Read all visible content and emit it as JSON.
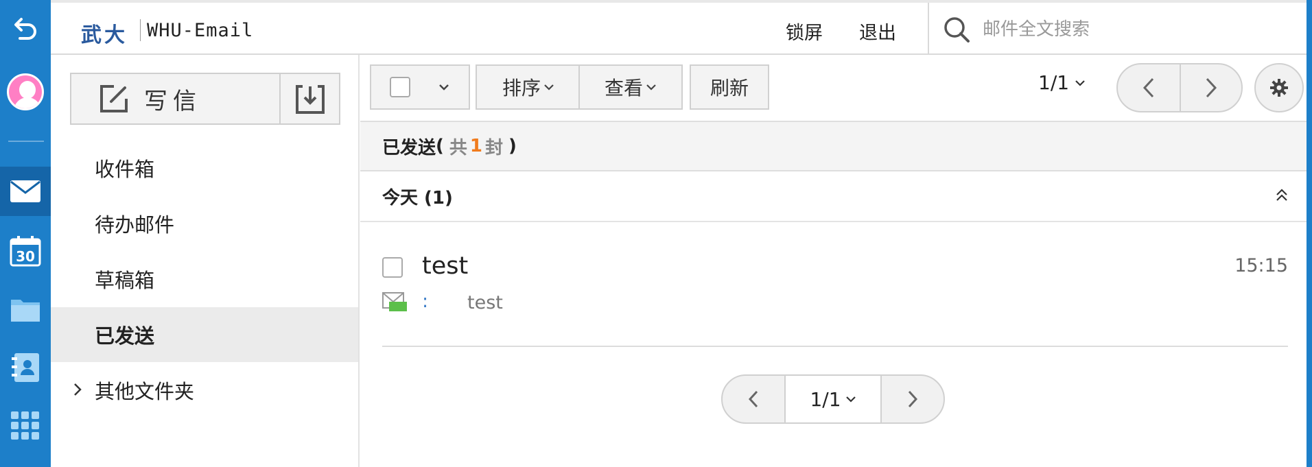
{
  "app": {
    "logo": "武大",
    "logo_sub": "WHU-Email"
  },
  "header": {
    "lock_label": "锁屏",
    "logout_label": "退出",
    "search_placeholder": "邮件全文搜索"
  },
  "rail": {
    "items": [
      "back-icon",
      "avatar",
      "mail-icon",
      "calendar-icon",
      "folder-icon",
      "contacts-icon",
      "apps-grid-icon"
    ],
    "calendar_day": "30",
    "active": "mail-icon"
  },
  "sidebar": {
    "compose_label": "写信",
    "folders": [
      {
        "label": "收件箱"
      },
      {
        "label": "待办邮件"
      },
      {
        "label": "草稿箱"
      },
      {
        "label": "已发送",
        "active": true
      },
      {
        "label": "其他文件夹",
        "expandable": true
      }
    ]
  },
  "toolbar": {
    "sort_label": "排序",
    "view_label": "查看",
    "refresh_label": "刷新",
    "page_indicator": "1/1"
  },
  "folder_header": {
    "name": "已发送",
    "open_paren": "(",
    "prefix": "共",
    "count": "1",
    "suffix": "封",
    "close_paren": ")"
  },
  "group": {
    "label": "今天 (1)"
  },
  "mails": [
    {
      "subject": "test",
      "time": "15:15",
      "separator": ":",
      "preview": "test"
    }
  ],
  "pagination": {
    "page_indicator": "1/1"
  },
  "colors": {
    "rail_bg": "#1d7fc9",
    "rail_active": "#1565a8",
    "count_accent": "#f07b1d",
    "logo": "#2a5a9e",
    "avatar": "#ff7fc4"
  }
}
